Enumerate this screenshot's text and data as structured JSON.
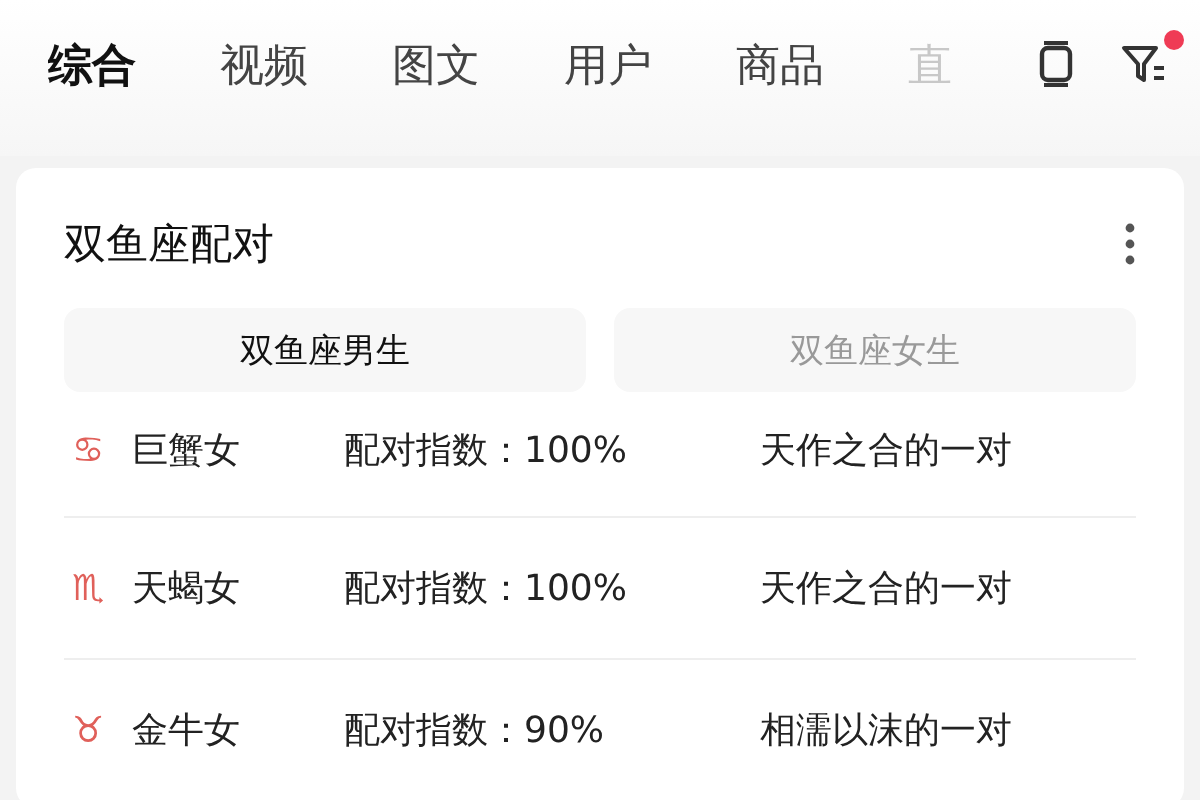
{
  "tabs": [
    {
      "label": "综合",
      "selected": true
    },
    {
      "label": "视频",
      "selected": false
    },
    {
      "label": "图文",
      "selected": false
    },
    {
      "label": "用户",
      "selected": false
    },
    {
      "label": "商品",
      "selected": false
    },
    {
      "label": "直",
      "selected": false
    }
  ],
  "filter_badge": true,
  "card": {
    "title": "双鱼座配对",
    "segments": [
      {
        "label": "双鱼座男生",
        "selected": true
      },
      {
        "label": "双鱼座女生",
        "selected": false
      }
    ],
    "rows": [
      {
        "sign": "♋",
        "name": "巨蟹女",
        "score": "配对指数：100%",
        "description": "天作之合的一对"
      },
      {
        "sign": "♏",
        "name": "天蝎女",
        "score": "配对指数：100%",
        "description": "天作之合的一对"
      },
      {
        "sign": "♉",
        "name": "金牛女",
        "score": "配对指数：90%",
        "description": "相濡以沫的一对"
      }
    ]
  }
}
